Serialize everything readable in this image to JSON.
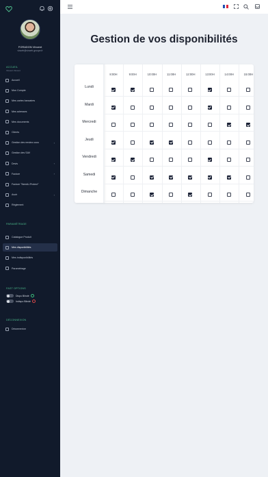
{
  "sidebar": {
    "user": {
      "name": "FORADON Vincent",
      "email": "vincefr@vincefr-groupe.fr"
    },
    "accueil_title": "ACCUEIL",
    "accueil_sub": "Vincent Vincent",
    "nav": [
      {
        "label": "Accueil",
        "chevron": ""
      },
      {
        "label": "Mon Compte",
        "chevron": ""
      },
      {
        "label": "Mes cartes bancaires",
        "chevron": ""
      },
      {
        "label": "Mes adresses",
        "chevron": ""
      },
      {
        "label": "Mes documents",
        "chevron": ""
      },
      {
        "label": "Clients",
        "chevron": ""
      },
      {
        "label": "Gestion des rendez-vous",
        "chevron": "›"
      },
      {
        "label": "Gestion des SAV",
        "chevron": ""
      },
      {
        "label": "Devis",
        "chevron": "›"
      },
      {
        "label": "Facture",
        "chevron": "›"
      },
      {
        "label": "Facture \"NeedU-Protect\"",
        "chevron": ""
      },
      {
        "label": "Avoir",
        "chevron": "›"
      },
      {
        "label": "Règlement",
        "chevron": ""
      }
    ],
    "params_title": "PARAMÉTRAGE",
    "params": [
      {
        "label": "Catalogue Produit",
        "active": false
      },
      {
        "label": "Mes disponibilités",
        "active": true
      },
      {
        "label": "Mes indisponibilités",
        "active": false
      },
      {
        "label": "Paramétrage",
        "active": false
      }
    ],
    "fast_title": "FAST OPTIONS",
    "fast": [
      {
        "label": "Dispo Blindé",
        "status": "ok"
      },
      {
        "label": "Indispo Blindé",
        "status": "no"
      }
    ],
    "deconnexion_title": "DÉCONNEXION",
    "logout_label": "Déconnexion"
  },
  "topbar": {
    "icons": [
      "menu-icon",
      "flag-fr-icon",
      "fullscreen-icon",
      "search-icon",
      "tray-icon"
    ]
  },
  "main": {
    "title": "Gestion de vos disponibilités",
    "hours": [
      "8:00H",
      "9:00H",
      "10:00H",
      "11:00H",
      "12:00H",
      "13:00H",
      "14:00H",
      "15:00H"
    ],
    "days": [
      "Lundi",
      "Mardi",
      "Mercredi",
      "Jeudi",
      "Vendredi",
      "Samedi",
      "Dimanche"
    ],
    "availability": [
      [
        true,
        true,
        false,
        false,
        false,
        true,
        false,
        false
      ],
      [
        true,
        false,
        false,
        false,
        false,
        true,
        false,
        false
      ],
      [
        false,
        false,
        false,
        false,
        false,
        false,
        true,
        true
      ],
      [
        true,
        false,
        true,
        true,
        false,
        false,
        false,
        false
      ],
      [
        true,
        true,
        false,
        false,
        false,
        true,
        false,
        false
      ],
      [
        true,
        false,
        true,
        true,
        true,
        true,
        true,
        false
      ],
      [
        false,
        false,
        true,
        false,
        true,
        false,
        false,
        false
      ]
    ]
  },
  "colors": {
    "sidebar_bg": "#111a2b",
    "accent": "#4dbb8c",
    "checkbox": "#1b2236"
  }
}
